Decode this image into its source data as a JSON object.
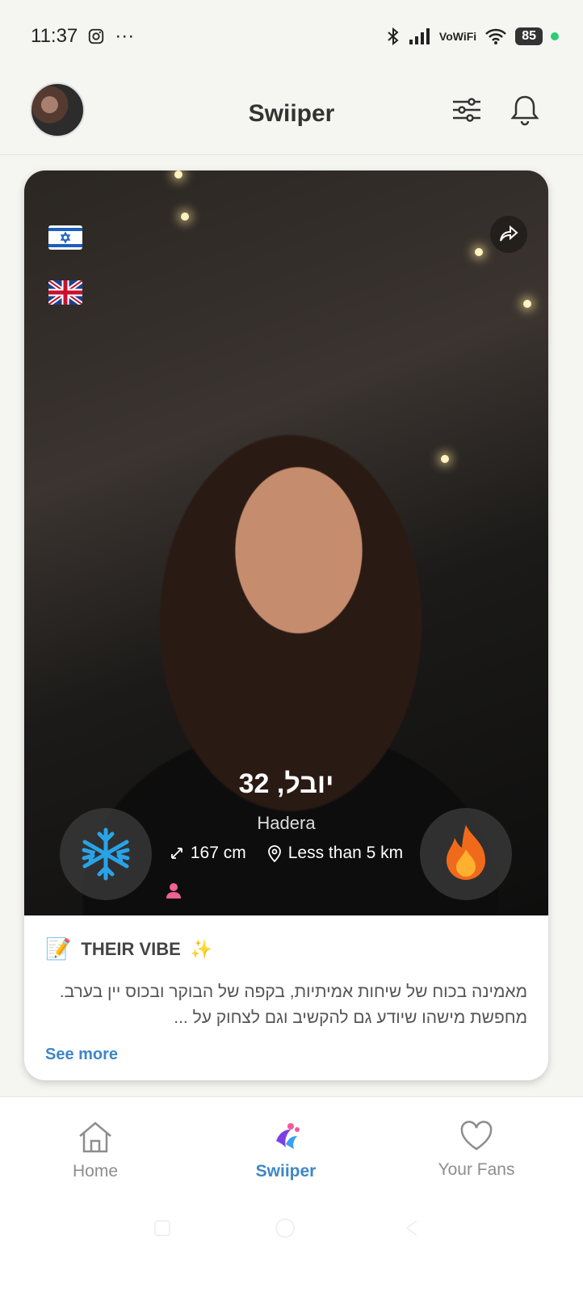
{
  "status_bar": {
    "time": "11:37",
    "dots": "···",
    "network": "VoWiFi",
    "battery": "85"
  },
  "header": {
    "title": "Swiiper"
  },
  "profile": {
    "name_age": "יובל, 32",
    "city": "Hadera",
    "height": "167 cm",
    "distance": "Less than 5 km",
    "languages": [
      "israel-flag",
      "uk-flag"
    ]
  },
  "vibe": {
    "emoji": "📝",
    "heading": "THEIR VIBE",
    "sparkle": "✨",
    "text": "מאמינה בכוח של שיחות אמיתיות, בקפה של הבוקר ובכוס יין בערב. מחפשת מישהו שיודע גם להקשיב וגם לצחוק על ...",
    "see_more": "See more"
  },
  "tabs": [
    {
      "label": "Home",
      "icon": "home-icon",
      "active": false
    },
    {
      "label": "Swiiper",
      "icon": "swiiper-logo-icon",
      "active": true
    },
    {
      "label": "Your Fans",
      "icon": "heart-icon",
      "active": false
    }
  ],
  "colors": {
    "accent": "#3f86c7",
    "ice": "#29a3e8",
    "fire": "#f06a1c"
  }
}
